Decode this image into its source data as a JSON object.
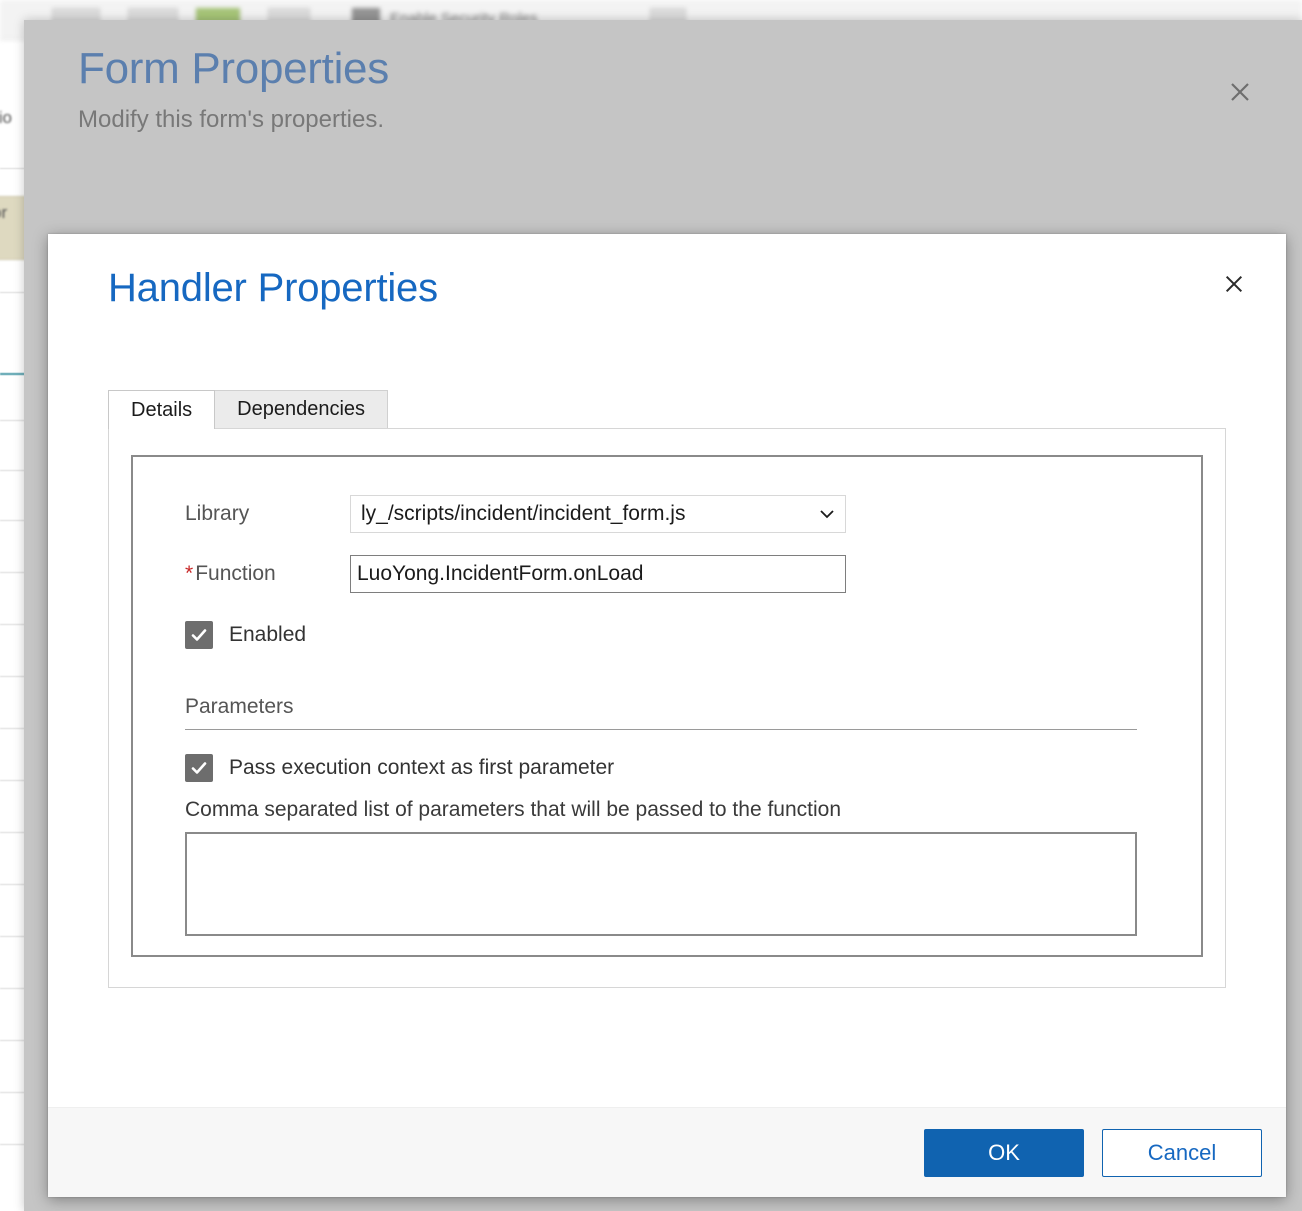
{
  "background": {
    "ribbon_labels": [
      "Enable Security Roles"
    ],
    "left_fragments": [
      "tio",
      "or"
    ]
  },
  "form_properties": {
    "title": "Form Properties",
    "subtitle": "Modify this form's properties.",
    "close_icon": "close-icon",
    "close_glyph": "✕",
    "title_color": "#5b7fae",
    "overlay_color": "#c5c5c5"
  },
  "handler_dialog": {
    "title": "Handler Properties",
    "title_color": "#1668c1",
    "close_icon": "close-icon",
    "close_glyph": "✕",
    "tabs": [
      {
        "label": "Details",
        "active": true
      },
      {
        "label": "Dependencies",
        "active": false
      }
    ],
    "fields": {
      "library": {
        "label": "Library",
        "value": "ly_/scripts/incident/incident_form.js",
        "icon": "chevron-down-icon"
      },
      "function": {
        "label": "Function",
        "required_marker": "*",
        "value": "LuoYong.IncidentForm.onLoad",
        "placeholder": ""
      },
      "enabled": {
        "label": "Enabled",
        "checked": true
      }
    },
    "parameters": {
      "section_label": "Parameters",
      "pass_context": {
        "label": "Pass execution context as first parameter",
        "checked": true
      },
      "hint": "Comma separated list of parameters that will be passed to the function",
      "value": "",
      "placeholder": ""
    },
    "footer": {
      "ok_label": "OK",
      "cancel_label": "Cancel",
      "primary_color": "#1063b0"
    }
  }
}
